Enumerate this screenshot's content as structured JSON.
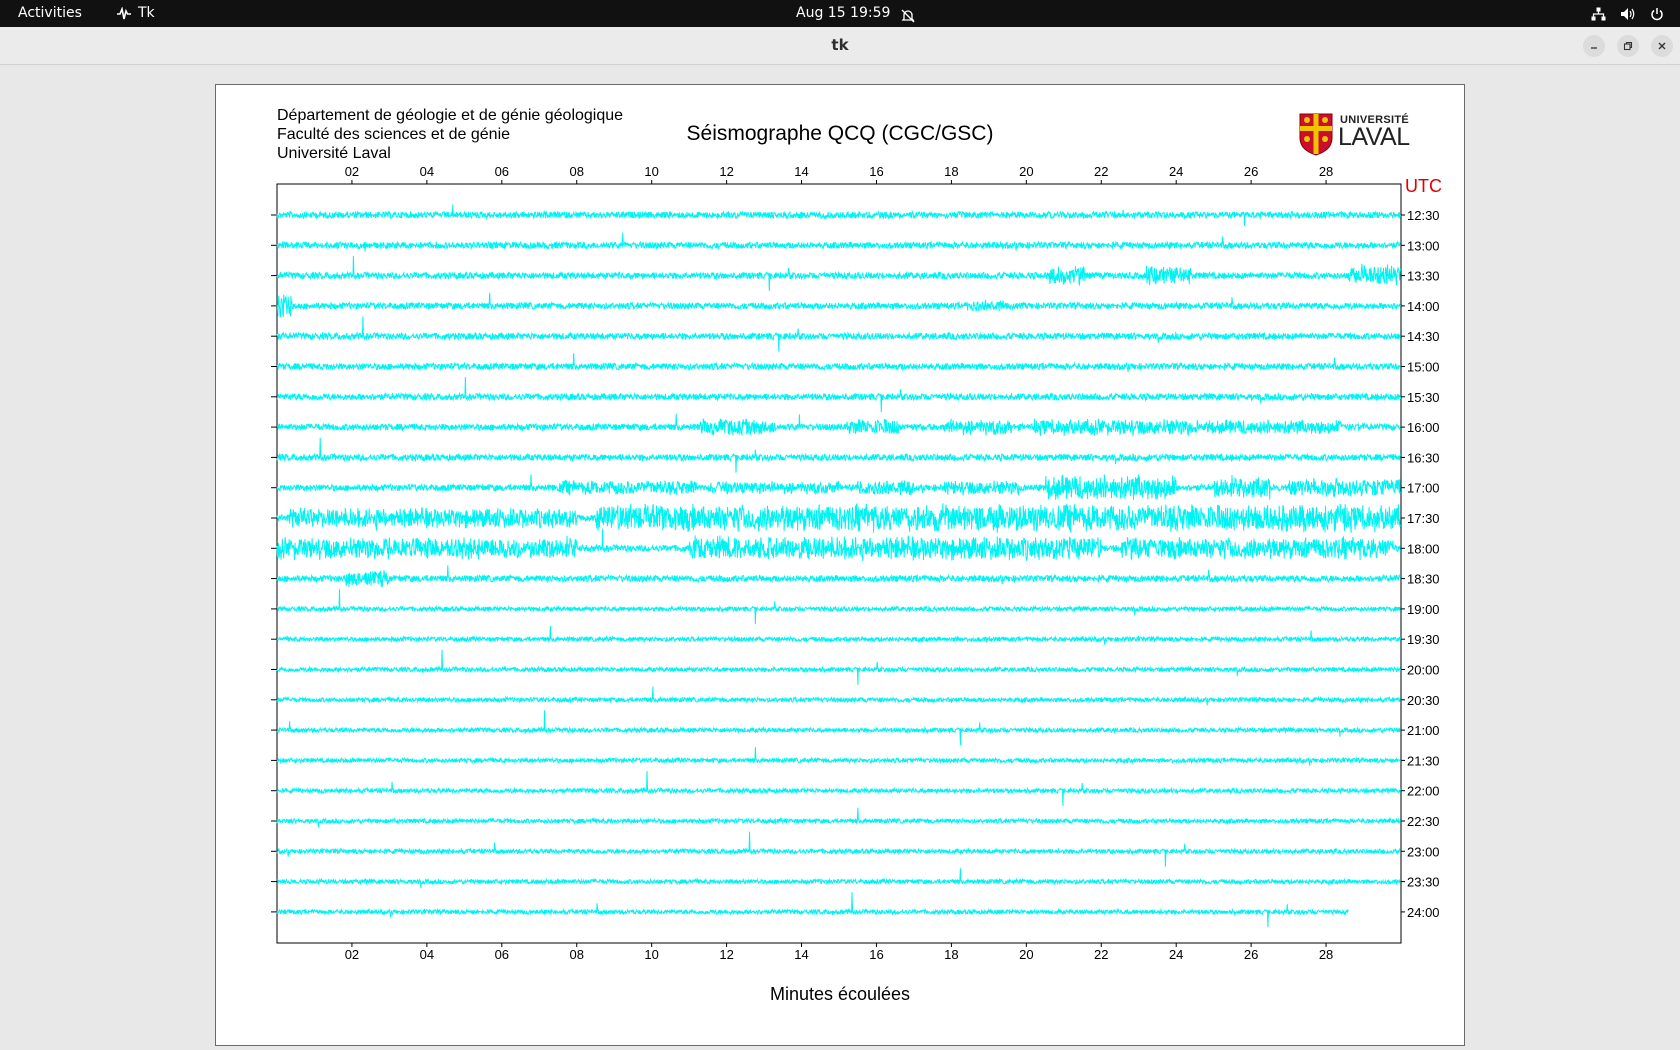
{
  "topbar": {
    "activities": "Activities",
    "app_name": "Tk",
    "clock": "Aug 15  19:59",
    "icons": [
      "network-icon",
      "volume-icon",
      "power-icon"
    ]
  },
  "window": {
    "title": "tk"
  },
  "figure": {
    "dept_lines": [
      "Département de géologie et de génie géologique",
      "Faculté des sciences et de génie",
      "Université Laval"
    ],
    "title": "Séismographe QCQ (CGC/GSC)",
    "utc_label": "UTC",
    "x_title": "Minutes écoulées",
    "logo": {
      "line1": "UNIVERSITÉ",
      "line2": "LAVAL"
    },
    "trace_color": "#00f2f2",
    "utc_color": "#e00000"
  },
  "chart_data": {
    "type": "line",
    "description_kind": "helicorder",
    "xlim": [
      0,
      30
    ],
    "x_ticks": [
      "02",
      "04",
      "06",
      "08",
      "10",
      "12",
      "14",
      "16",
      "18",
      "20",
      "22",
      "24",
      "26",
      "28"
    ],
    "x_tick_values": [
      2,
      4,
      6,
      8,
      10,
      12,
      14,
      16,
      18,
      20,
      22,
      24,
      26,
      28
    ],
    "rows": [
      "12:30",
      "13:00",
      "13:30",
      "14:00",
      "14:30",
      "15:00",
      "15:30",
      "16:00",
      "16:30",
      "17:00",
      "17:30",
      "18:00",
      "18:30",
      "19:00",
      "19:30",
      "20:00",
      "20:30",
      "21:00",
      "21:30",
      "22:00",
      "22:30",
      "23:00",
      "23:30",
      "24:00"
    ],
    "last_row_end_minute": 28.6
  }
}
